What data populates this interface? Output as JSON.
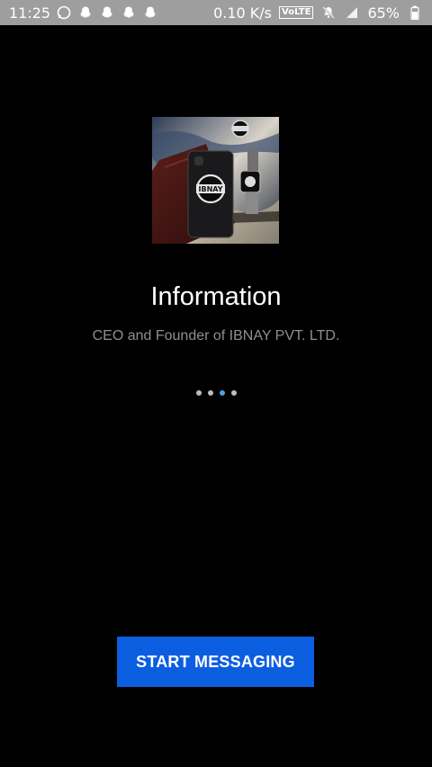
{
  "status_bar": {
    "time": "11:25",
    "net_speed": "0.10 K/s",
    "volte": "VoLTE",
    "battery": "65%",
    "icons": [
      "whatsapp-icon",
      "snapchat-icon",
      "snapchat-icon",
      "snapchat-icon",
      "snapchat-icon",
      "mute-icon",
      "signal-icon",
      "battery-icon"
    ]
  },
  "onboarding": {
    "hero_logo_text": "IBNAY",
    "title": "Information",
    "subtitle": "CEO and Founder of IBNAY PVT. LTD.",
    "page_total": 4,
    "page_active_index": 2,
    "start_button": "START MESSAGING"
  },
  "colors": {
    "background": "#000000",
    "accent": "#0c5ee0",
    "active_dot": "#4aa3e0"
  }
}
